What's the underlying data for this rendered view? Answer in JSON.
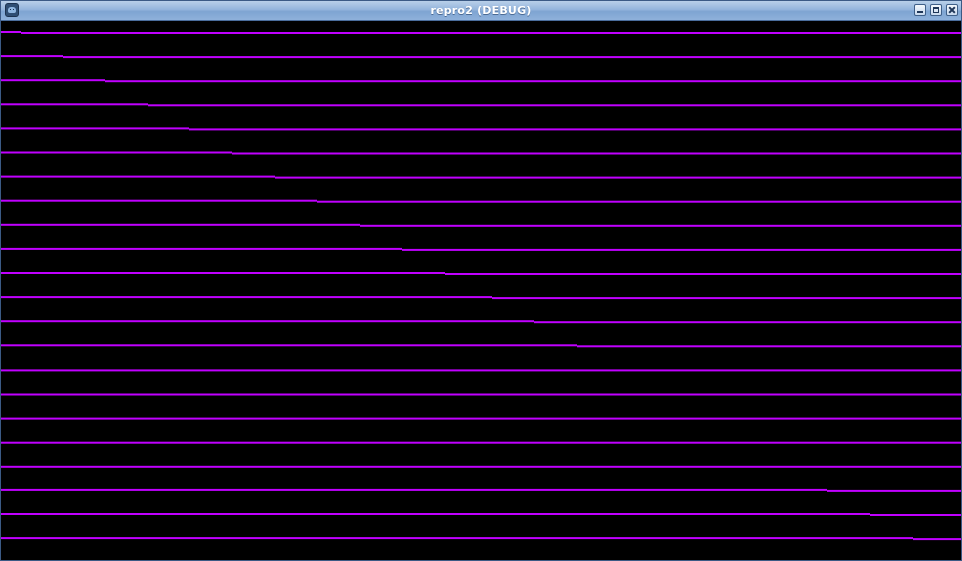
{
  "window": {
    "title": "repro2 (DEBUG)",
    "app_icon": "godot-engine-icon",
    "controls": {
      "minimize": "minimize-icon",
      "maximize": "maximize-icon",
      "close": "close-icon"
    }
  },
  "viewport": {
    "background": "#000000",
    "line_color": "#c000ff",
    "lines": [
      {
        "step_fraction": 0.021
      },
      {
        "step_fraction": 0.065
      },
      {
        "step_fraction": 0.108
      },
      {
        "step_fraction": 0.153
      },
      {
        "step_fraction": 0.196
      },
      {
        "step_fraction": 0.241
      },
      {
        "step_fraction": 0.285
      },
      {
        "step_fraction": 0.329
      },
      {
        "step_fraction": 0.374
      },
      {
        "step_fraction": 0.418
      },
      {
        "step_fraction": 0.463
      },
      {
        "step_fraction": 0.511
      },
      {
        "step_fraction": 0.555
      },
      {
        "step_fraction": 0.6
      },
      {
        "step_fraction": 0.0
      },
      {
        "step_fraction": 0.0
      },
      {
        "step_fraction": 0.0
      },
      {
        "step_fraction": 0.0
      },
      {
        "step_fraction": 0.0
      },
      {
        "step_fraction": 0.86
      },
      {
        "step_fraction": 0.905
      },
      {
        "step_fraction": 0.95
      }
    ]
  }
}
